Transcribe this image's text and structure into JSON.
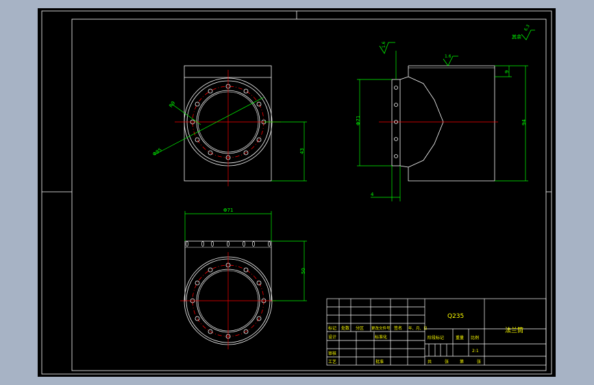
{
  "colors": {
    "background": "#a7b3c5",
    "sheet": "#000000",
    "outline": "#ffffff",
    "dimension": "#00ff00",
    "centerline": "#ff0000",
    "tabletext": "#ffff00"
  },
  "icons": {
    "roughness_symbol": "surface-roughness-icon"
  },
  "annotations": {
    "roughness_general": "6.3",
    "roughness_general_note": "其余",
    "roughness_left": "1.6",
    "roughness_top": "1.6"
  },
  "dimensions": {
    "front_radius": "R9",
    "front_diameter": "Φ85",
    "front_height": "43",
    "side_diameter": "Φ71",
    "side_top": "9",
    "side_height": "94",
    "side_bottom": "4",
    "top_width": "Φ71",
    "top_height": "50"
  },
  "title_block": {
    "material": "Q235",
    "part_name": "法兰筒",
    "headers": [
      "标记",
      "处数",
      "分区",
      "更改文件号",
      "签名",
      "年、月、日"
    ],
    "row_design": "设计",
    "row_standard": "标准化",
    "row_stage": "阶段标记",
    "row_weight": "重量",
    "row_scale": "比例",
    "scale_value": "2:1",
    "row_review": "审核",
    "row_process": "工艺",
    "row_approve": "批准",
    "sheets": [
      "共",
      "张",
      "第",
      "张"
    ]
  }
}
